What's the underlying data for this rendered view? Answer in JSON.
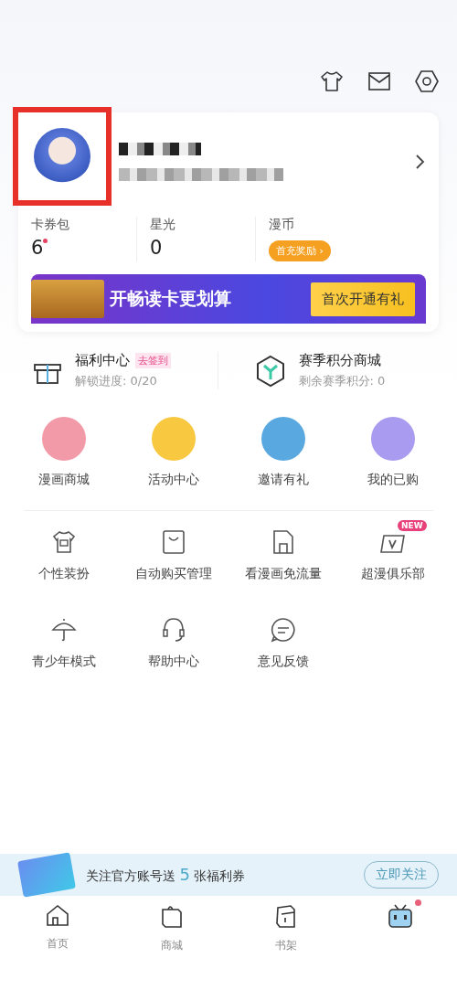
{
  "stats": [
    {
      "label": "卡券包",
      "value": "6",
      "dot": true
    },
    {
      "label": "星光",
      "value": "0",
      "dot": false
    },
    {
      "label": "漫币",
      "button": "首充奖励 ›"
    }
  ],
  "promo": {
    "text": "开畅读卡更划算",
    "button": "首次开通有礼"
  },
  "welfare": [
    {
      "kind": "gift",
      "title": "福利中心",
      "tag": "去签到",
      "sub": "解锁进度:  0/20"
    },
    {
      "kind": "cube",
      "title": "赛季积分商城",
      "sub": "剩余赛季积分: 0"
    }
  ],
  "features": [
    {
      "label": "漫画商城",
      "color": "#f39aa8"
    },
    {
      "label": "活动中心",
      "color": "#f8c840"
    },
    {
      "label": "邀请有礼",
      "color": "#5aa8e0"
    },
    {
      "label": "我的已购",
      "color": "#a99cf0"
    }
  ],
  "tools": [
    {
      "kind": "shirt",
      "label": "个性装扮"
    },
    {
      "kind": "bag",
      "label": "自动购买管理"
    },
    {
      "kind": "sim",
      "label": "看漫画免流量"
    },
    {
      "kind": "vcard",
      "label": "超漫俱乐部",
      "badge": "NEW"
    },
    {
      "kind": "umbrella",
      "label": "青少年模式"
    },
    {
      "kind": "headset",
      "label": "帮助中心"
    },
    {
      "kind": "chat",
      "label": "意见反馈"
    }
  ],
  "follow": {
    "before": "关注官方账号送",
    "count": "5",
    "after": "张福利券",
    "button": "立即关注"
  },
  "tabs": [
    {
      "kind": "home",
      "label": "首页",
      "selected": false,
      "dot": false
    },
    {
      "kind": "shop",
      "label": "商城",
      "selected": false,
      "dot": false
    },
    {
      "kind": "books",
      "label": "书架",
      "selected": false,
      "dot": false
    },
    {
      "kind": "robot",
      "selected": true,
      "dot": true
    }
  ]
}
